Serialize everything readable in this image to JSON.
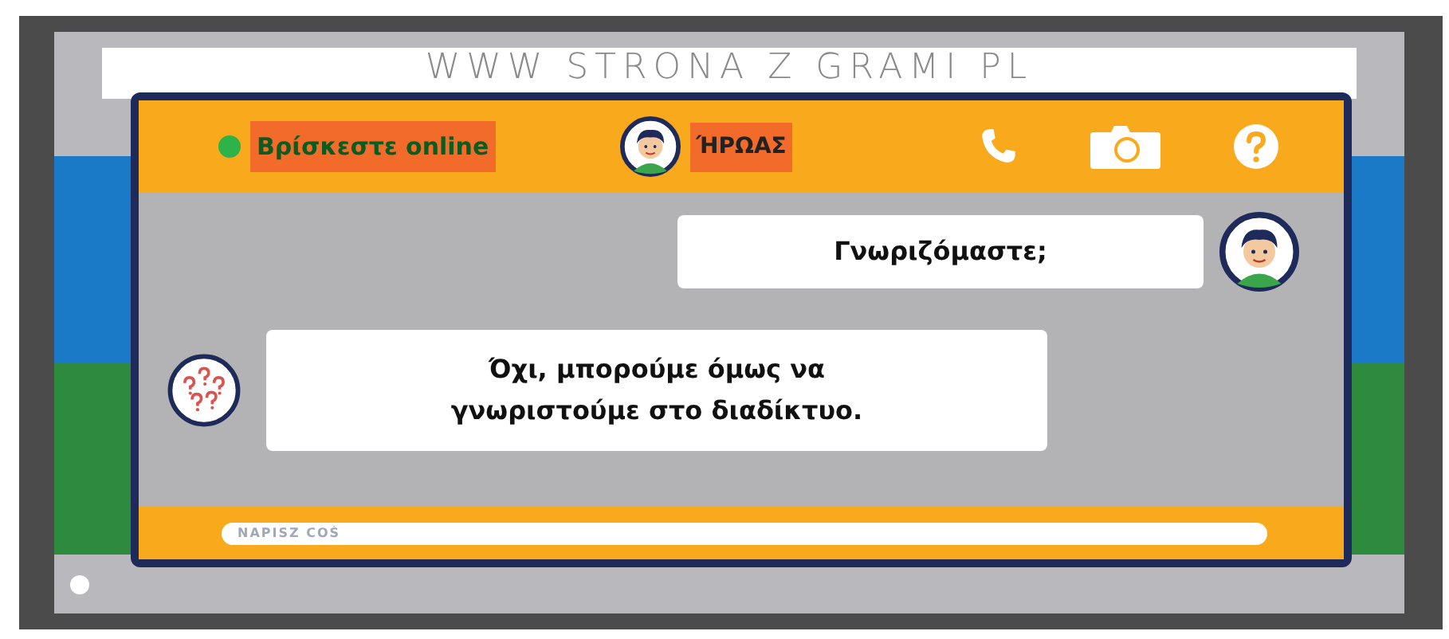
{
  "url_bar": {
    "text": "WWW STRONA Z GRAMI PL"
  },
  "chat": {
    "status": {
      "text": "Βρίσκεστε online",
      "online": true
    },
    "contact": {
      "name": "ΉΡΩΑΣ"
    },
    "messages": [
      {
        "kind": "sent",
        "text": "Γνωριζόμαστε;"
      },
      {
        "kind": "received",
        "text": "Όχι, μπορούμε όμως να γνωριστούμε στο διαδίκτυο."
      }
    ],
    "input": {
      "placeholder": "NAPISZ COŚ"
    }
  }
}
